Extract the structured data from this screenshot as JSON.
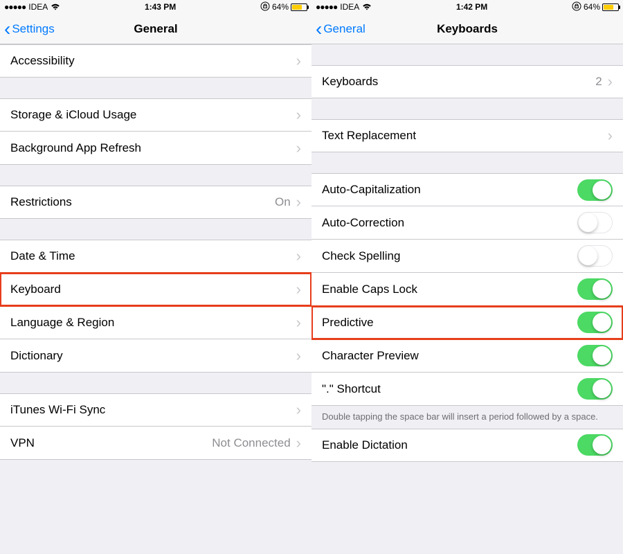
{
  "left": {
    "status": {
      "carrier": "IDEA",
      "time": "1:43 PM",
      "battery": "64%"
    },
    "nav": {
      "back": "Settings",
      "title": "General"
    },
    "rows": {
      "accessibility": "Accessibility",
      "storage": "Storage & iCloud Usage",
      "background_refresh": "Background App Refresh",
      "restrictions": {
        "label": "Restrictions",
        "value": "On"
      },
      "date_time": "Date & Time",
      "keyboard": "Keyboard",
      "language_region": "Language & Region",
      "dictionary": "Dictionary",
      "itunes_wifi": "iTunes Wi-Fi Sync",
      "vpn": {
        "label": "VPN",
        "value": "Not Connected"
      }
    }
  },
  "right": {
    "status": {
      "carrier": "IDEA",
      "time": "1:42 PM",
      "battery": "64%"
    },
    "nav": {
      "back": "General",
      "title": "Keyboards"
    },
    "rows": {
      "keyboards": {
        "label": "Keyboards",
        "value": "2"
      },
      "text_replacement": "Text Replacement",
      "auto_cap": "Auto-Capitalization",
      "auto_correct": "Auto-Correction",
      "check_spelling": "Check Spelling",
      "caps_lock": "Enable Caps Lock",
      "predictive": "Predictive",
      "char_preview": "Character Preview",
      "shortcut": "\".\" Shortcut",
      "dictation": "Enable Dictation"
    },
    "footer": "Double tapping the space bar will insert a period followed by a space.",
    "toggle_states": {
      "auto_cap": true,
      "auto_correct": false,
      "check_spelling": false,
      "caps_lock": true,
      "predictive": true,
      "char_preview": true,
      "shortcut": true,
      "dictation": true
    }
  }
}
